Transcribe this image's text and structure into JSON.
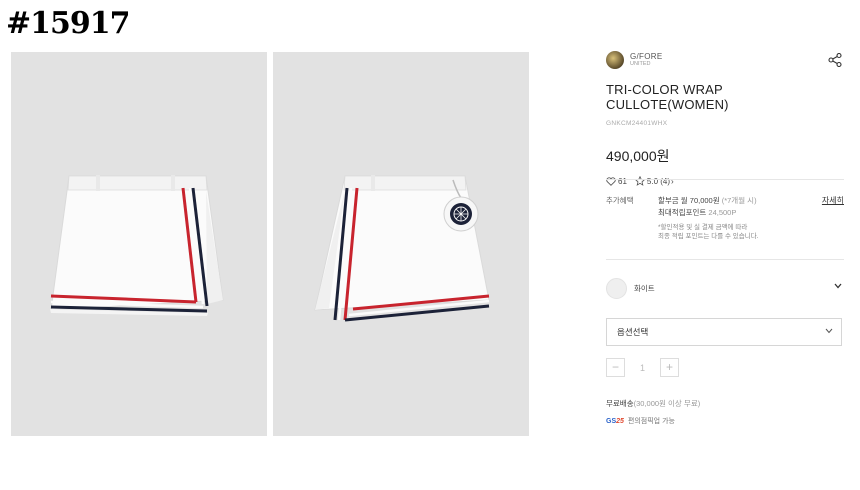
{
  "tag": "#15917",
  "gallery": {
    "images": [
      {
        "alt": "white wrap culotte front with red and navy stripes"
      },
      {
        "alt": "white wrap culotte back with round golf ball pouch"
      }
    ]
  },
  "brand": {
    "name": "G/FORE",
    "sub": "UNITED"
  },
  "product": {
    "title": "TRI-COLOR WRAP CULLOTE(WOMEN)",
    "code": "GNKCM24401WHX",
    "price": "490,000원",
    "likes": "61",
    "rating": "5.0",
    "reviews": "(4)"
  },
  "benefits": {
    "label": "추가혜택",
    "line1_a": "할부금 월 70,000원",
    "line1_b": "(*7개월 시)",
    "line2_a": "최대적립포인트",
    "line2_b": "24,500P",
    "note1": "*할인적용 및 실 결제 금액에 따라",
    "note2": "최종 적립 포인트는 다를 수 있습니다.",
    "more": "자세히"
  },
  "color": {
    "name": "화이트",
    "swatch": "#efefef"
  },
  "option": {
    "placeholder": "옵션선택"
  },
  "quantity": {
    "minus": "−",
    "value": "1",
    "plus": "+"
  },
  "shipping": {
    "a": "무료배송",
    "b": "(30,000원 이상 무료)"
  },
  "gs": {
    "logo_a": "GS",
    "logo_b": "25",
    "text": "편의점픽업 가능"
  },
  "icons": {
    "share": "share-icon",
    "heart": "heart-icon",
    "star": "star-icon",
    "chevron": "chevron-down-icon"
  },
  "colors": {
    "red": "#c8242e",
    "navy": "#1c2238",
    "photo_bg": "#e2e2e2"
  }
}
